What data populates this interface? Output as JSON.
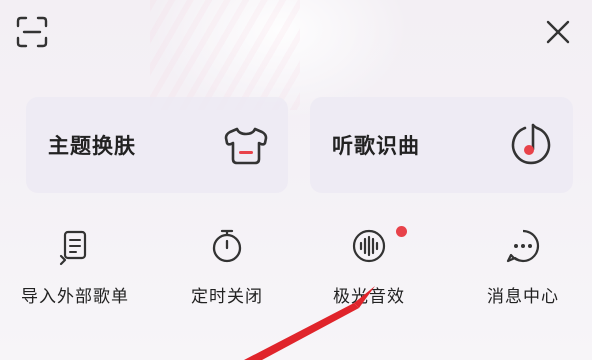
{
  "header": {
    "scan_icon": "scan-icon",
    "close_icon": "close-icon"
  },
  "cards": [
    {
      "label": "主题换肤",
      "icon": "tshirt-icon"
    },
    {
      "label": "听歌识曲",
      "icon": "music-recognize-icon"
    }
  ],
  "shortcuts": [
    {
      "label": "导入外部歌单",
      "icon": "import-playlist-icon"
    },
    {
      "label": "定时关闭",
      "icon": "timer-icon"
    },
    {
      "label": "极光音效",
      "icon": "sound-wave-icon",
      "badge": "red-dot"
    },
    {
      "label": "消息中心",
      "icon": "message-icon"
    }
  ],
  "colors": {
    "accent": "#e8424a",
    "text": "#222222",
    "card_bg": "#eceaf3"
  }
}
